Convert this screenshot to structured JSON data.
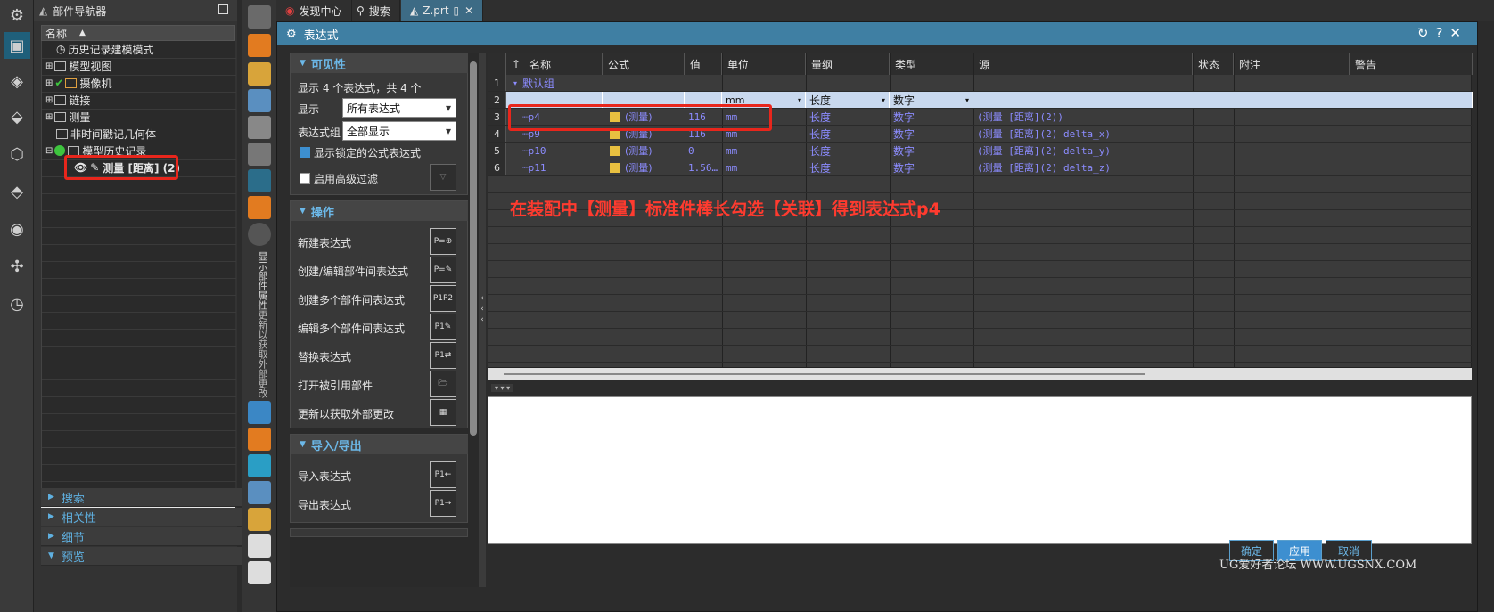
{
  "tabs": [
    "发现中心",
    "搜索",
    "Z.prt"
  ],
  "navigator": {
    "title": "部件导航器",
    "column_header": "名称",
    "tree": [
      {
        "label": "历史记录建模模式",
        "indent": 0
      },
      {
        "label": "模型视图",
        "indent": 0
      },
      {
        "label": "摄像机",
        "indent": 0
      },
      {
        "label": "链接",
        "indent": 0
      },
      {
        "label": "测量",
        "indent": 0
      },
      {
        "label": "非时间戳记几何体",
        "indent": 0
      },
      {
        "label": "模型历史记录",
        "indent": 0
      },
      {
        "label": "测量 [距离] (2)",
        "indent": 1
      }
    ],
    "sections": [
      "搜索",
      "相关性",
      "细节",
      "预览"
    ]
  },
  "vertical_toolbar": {
    "label_1": "显示部件属性",
    "label_2": "更新以获取外部更改"
  },
  "dialog": {
    "title": "表达式",
    "visibility": {
      "header": "可见性",
      "summary": "显示 4 个表达式，共 4 个",
      "show_label": "显示",
      "show_value": "所有表达式",
      "group_label": "表达式组",
      "group_value": "全部显示",
      "show_locked": "显示锁定的公式表达式",
      "advanced_filter": "启用高级过滤"
    },
    "operations": {
      "header": "操作",
      "items": [
        "新建表达式",
        "创建/编辑部件间表达式",
        "创建多个部件间表达式",
        "编辑多个部件间表达式",
        "替换表达式",
        "打开被引用部件",
        "更新以获取外部更改"
      ]
    },
    "import_export": {
      "header": "导入/导出",
      "items": [
        "导入表达式",
        "导出表达式"
      ]
    },
    "grid": {
      "columns": [
        "名称",
        "公式",
        "值",
        "单位",
        "量纲",
        "类型",
        "源",
        "状态",
        "附注",
        "警告"
      ],
      "group_row": "默认组",
      "edit_row": {
        "unit": "mm",
        "dimension": "长度",
        "type": "数字"
      },
      "rows": [
        {
          "num": "3",
          "name": "p4",
          "formula": "(测量)",
          "value": "116",
          "unit": "mm",
          "dimension": "长度",
          "type": "数字",
          "source": "(测量 [距离](2))"
        },
        {
          "num": "4",
          "name": "p9",
          "formula": "(测量)",
          "value": "116",
          "unit": "mm",
          "dimension": "长度",
          "type": "数字",
          "source": "(测量 [距离](2) delta_x)"
        },
        {
          "num": "5",
          "name": "p10",
          "formula": "(测量)",
          "value": "0",
          "unit": "mm",
          "dimension": "长度",
          "type": "数字",
          "source": "(测量 [距离](2) delta_y)"
        },
        {
          "num": "6",
          "name": "p11",
          "formula": "(测量)",
          "value": "1.56…",
          "unit": "mm",
          "dimension": "长度",
          "type": "数字",
          "source": "(测量 [距离](2) delta_z)"
        }
      ]
    },
    "buttons": {
      "ok": "确定",
      "apply": "应用",
      "cancel": "取消"
    }
  },
  "annotation": "在装配中【测量】标准件棒长勾选【关联】得到表达式p4",
  "watermark": "UG爱好者论坛 WWW.UGSNX.COM",
  "colors": {
    "accent": "#3f7fa3",
    "highlight_red": "#e8261c",
    "link_blue": "#8c8cff"
  }
}
